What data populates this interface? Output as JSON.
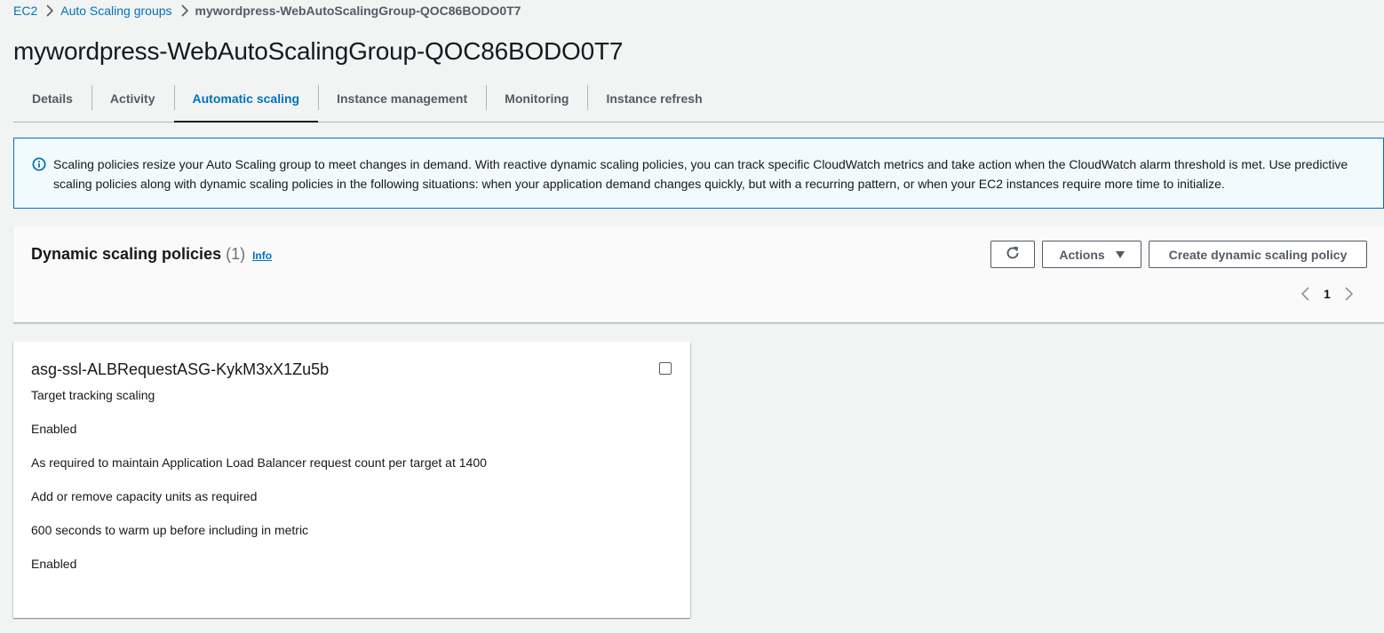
{
  "breadcrumb": {
    "items": [
      "EC2",
      "Auto Scaling groups"
    ],
    "current": "mywordpress-WebAutoScalingGroup-QOC86BODO0T7"
  },
  "page": {
    "title": "mywordpress-WebAutoScalingGroup-QOC86BODO0T7"
  },
  "tabs": [
    {
      "label": "Details",
      "active": false
    },
    {
      "label": "Activity",
      "active": false
    },
    {
      "label": "Automatic scaling",
      "active": true
    },
    {
      "label": "Instance management",
      "active": false
    },
    {
      "label": "Monitoring",
      "active": false
    },
    {
      "label": "Instance refresh",
      "active": false
    }
  ],
  "alert": {
    "text": "Scaling policies resize your Auto Scaling group to meet changes in demand. With reactive dynamic scaling policies, you can track specific CloudWatch metrics and take action when the CloudWatch alarm threshold is met. Use predictive scaling policies along with dynamic scaling policies in the following situations: when your application demand changes quickly, but with a recurring pattern, or when your EC2 instances require more time to initialize."
  },
  "policies_section": {
    "heading": "Dynamic scaling policies",
    "count": "(1)",
    "info": "Info",
    "actions_label": "Actions",
    "create_label": "Create dynamic scaling policy",
    "page": "1"
  },
  "policy": {
    "name": "asg-ssl-ALBRequestASG-KykM3xX1Zu5b",
    "type": "Target tracking scaling",
    "status": "Enabled",
    "target": "As required to maintain Application Load Balancer request count per target at 1400",
    "action": "Add or remove capacity units as required",
    "warmup": "600 seconds to warm up before including in metric",
    "scale_in": "Enabled"
  },
  "colors": {
    "link": "#0073bb",
    "background": "#f2f3f3",
    "alert_bg": "#f1faff"
  }
}
